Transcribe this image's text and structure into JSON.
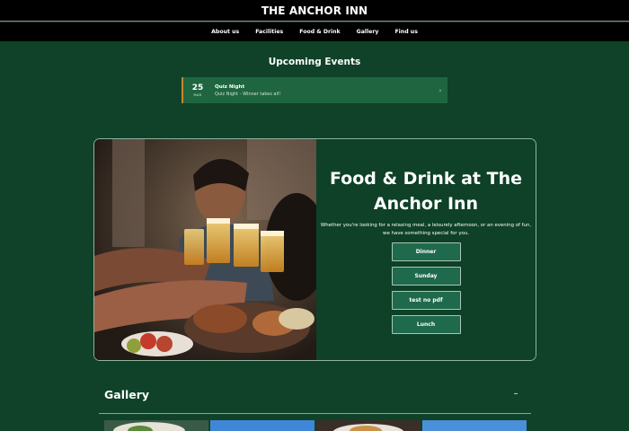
{
  "header": {
    "site_title": "THE ANCHOR INN"
  },
  "nav": {
    "items": [
      {
        "label": "About us"
      },
      {
        "label": "Facilities"
      },
      {
        "label": "Food & Drink"
      },
      {
        "label": "Gallery"
      },
      {
        "label": "Find us"
      }
    ]
  },
  "events": {
    "heading": "Upcoming Events",
    "items": [
      {
        "day": "25",
        "month": "MAR",
        "title": "Quiz Night",
        "subtitle": "Quiz Night - Winner takes all!",
        "chevron_icon": "chevron-right-icon"
      }
    ]
  },
  "feature": {
    "image": "friends-toasting-beers-photo",
    "title": "Food & Drink at The Anchor Inn",
    "description": "Whether you're looking for a relaxing meal, a leisurely afternoon, or an evening of fun, we have something special for you.",
    "menus": [
      {
        "label": "Dinner"
      },
      {
        "label": "Sunday"
      },
      {
        "label": "test no pdf"
      },
      {
        "label": "Lunch"
      }
    ]
  },
  "gallery": {
    "heading": "Gallery",
    "toggle_icon": "minus-icon",
    "toggle_symbol": "–"
  },
  "colors": {
    "page_background": "#0f4228",
    "header_background": "#000000",
    "event_card": "#1f6640",
    "event_accent": "#c9852f",
    "menu_button": "#1f6a4c"
  }
}
